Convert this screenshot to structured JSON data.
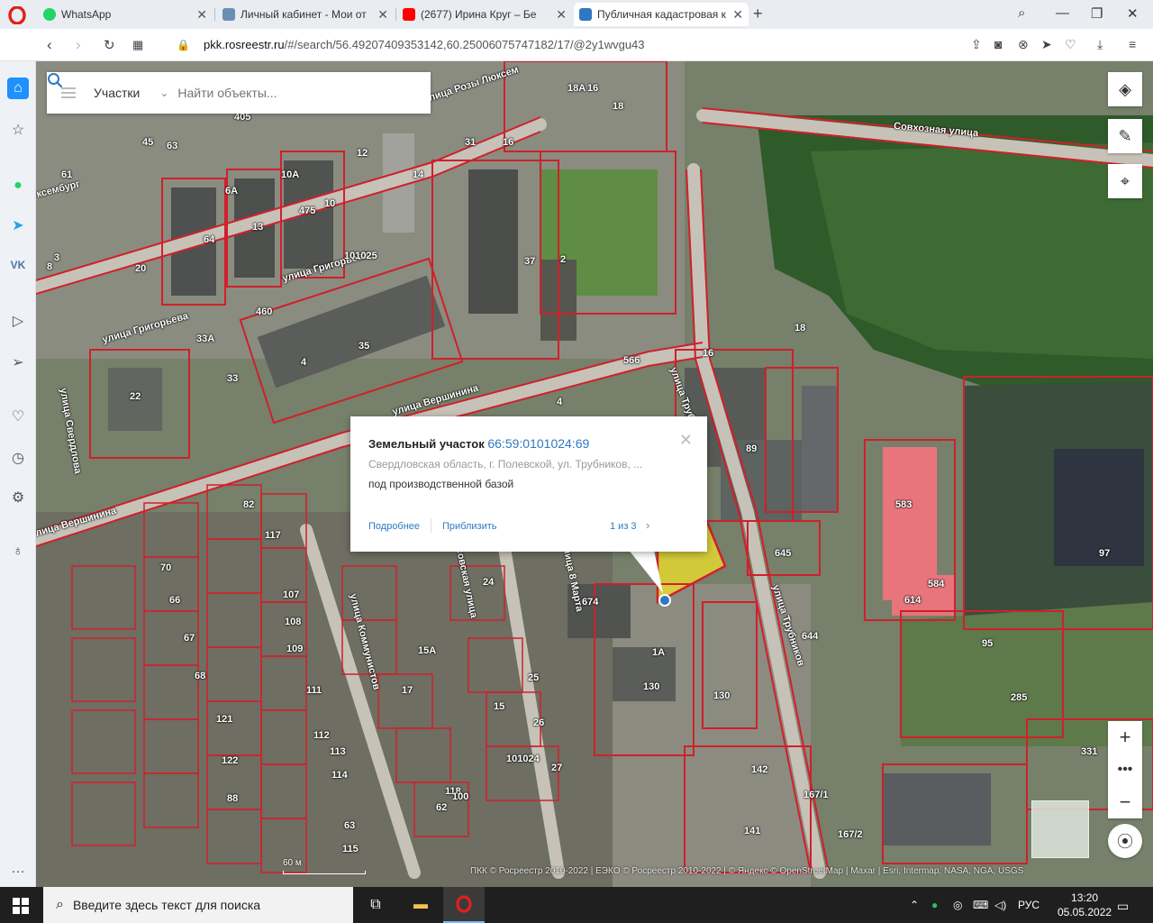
{
  "browser": {
    "tabs": [
      {
        "label": "WhatsApp",
        "icon": "whatsapp-icon",
        "color": "#25d366"
      },
      {
        "label": "Личный кабинет - Мои от",
        "icon": "cabinet-icon",
        "color": "#6a8fb5"
      },
      {
        "label": "(2677) Ирина Круг – Бе",
        "icon": "youtube-icon",
        "color": "#ff0000"
      },
      {
        "label": "Публичная кадастровая к",
        "icon": "cadastre-icon",
        "color": "#2f78c4"
      }
    ],
    "url_host": "pkk.rosreestr.ru",
    "url_path": "/#/search/56.49207409353142,60.25006075747182/17/@2y1wvgu43"
  },
  "search": {
    "type_label": "Участки",
    "placeholder": "Найти объекты..."
  },
  "popup": {
    "title": "Земельный участок",
    "cadastral_number": "66:59:0101024:69",
    "address": "Свердловская область, г. Полевской, ул. Трубников, ...",
    "usage": "под производственной базой",
    "link_more": "Подробнее",
    "link_zoom": "Приблизить",
    "pager": "1 из 3"
  },
  "map": {
    "streets": [
      {
        "text": "Совхозная улица"
      },
      {
        "text": "улица Григорьева"
      },
      {
        "text": "улица Григорьева"
      },
      {
        "text": "улица Вершинина"
      },
      {
        "text": "улица Вершинина"
      },
      {
        "text": "улица Трубников"
      },
      {
        "text": "улица Трубников"
      },
      {
        "text": "улица Свердлова"
      },
      {
        "text": "улица Коммунистов"
      },
      {
        "text": "улица 8 Марта"
      },
      {
        "text": "Чусовская улица"
      },
      {
        "text": "ксембург"
      },
      {
        "text": "улица Розы Люксем"
      }
    ],
    "parcel_labels": [
      "18А",
      "16",
      "18",
      "31",
      "16",
      "45",
      "63",
      "405",
      "12",
      "61",
      "10А",
      "14",
      "6А",
      "10",
      "475",
      "13",
      "64",
      "101025",
      "37",
      "2",
      "20",
      "3",
      "8",
      "460",
      "33А",
      "35",
      "4",
      "22",
      "33",
      "18",
      "16",
      "566",
      "89",
      "4",
      "583",
      "584",
      "614",
      "97",
      "645",
      "644",
      "95",
      "285",
      "331",
      "674",
      "1А",
      "130",
      "130",
      "82",
      "117",
      "70",
      "66",
      "107",
      "108",
      "109",
      "67",
      "68",
      "121",
      "111",
      "112",
      "113",
      "114",
      "118",
      "25",
      "26",
      "101024",
      "27",
      "100",
      "122",
      "88",
      "142",
      "141",
      "167/1",
      "167/2",
      "10",
      "8",
      "115",
      "63",
      "24",
      "15А",
      "17",
      "15",
      "62"
    ],
    "scale_label": "60 м",
    "attribution": "ПКК © Росреестр 2010-2022 | ЕЭКО © Росреестр 2010-2022 | © Яндекс © OpenStreetMap | Maxar | Esri, Intermap, NASA, NGA, USGS",
    "accent_color": "#d0202a",
    "highlight_color": "#f2e22a"
  },
  "taskbar": {
    "search_text": "Введите здесь текст для поиска",
    "lang": "РУС",
    "time": "13:20",
    "date": "05.05.2022"
  }
}
